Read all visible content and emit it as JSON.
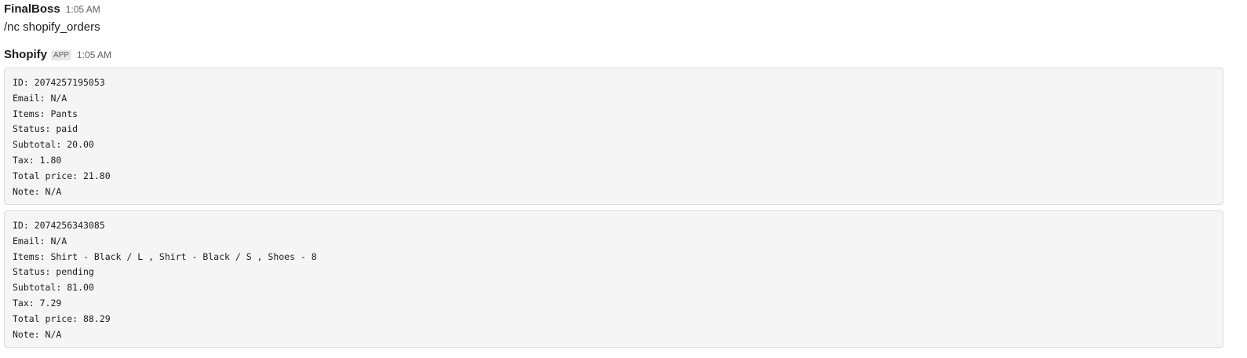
{
  "messages": [
    {
      "author": "FinalBoss",
      "time": "1:05 AM",
      "text": "/nc shopify_orders"
    },
    {
      "author": "Shopify",
      "badge": "APP",
      "time": "1:05 AM"
    }
  ],
  "orders": [
    {
      "lines": [
        "ID: 2074257195053",
        "Email: N/A",
        "Items: Pants",
        "Status: paid",
        "Subtotal: 20.00",
        "Tax: 1.80",
        "Total price: 21.80",
        "Note: N/A"
      ]
    },
    {
      "lines": [
        "ID: 2074256343085",
        "Email: N/A",
        "Items: Shirt - Black / L , Shirt - Black / S , Shoes - 8",
        "Status: pending",
        "Subtotal: 81.00",
        "Tax: 7.29",
        "Total price: 88.29",
        "Note: N/A"
      ]
    }
  ]
}
